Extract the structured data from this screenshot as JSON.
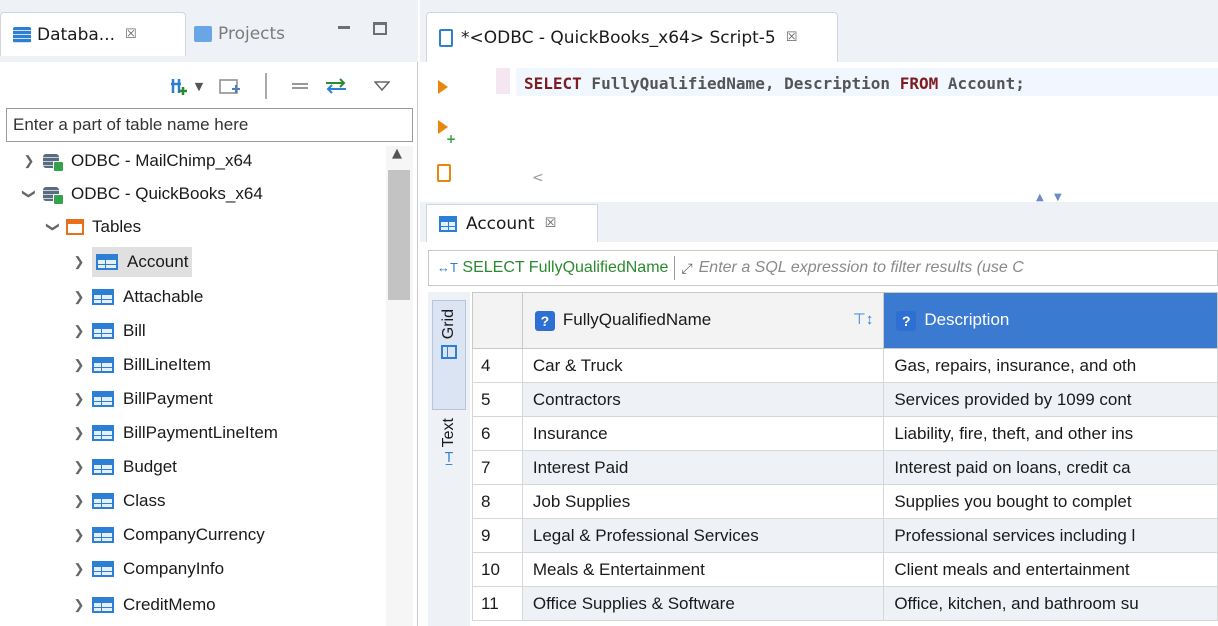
{
  "left_panel": {
    "tabs": [
      {
        "label": "Databa...",
        "close": "☒"
      },
      {
        "label": "Projects"
      }
    ],
    "filter_placeholder": "Enter a part of table name here",
    "tree": [
      {
        "label": "ODBC - MailChimp_x64",
        "type": "connection",
        "expanded": false
      },
      {
        "label": "ODBC - QuickBooks_x64",
        "type": "connection",
        "expanded": true
      },
      {
        "label": "Tables",
        "type": "folder",
        "expanded": true
      },
      {
        "label": "Account",
        "type": "table",
        "selected": true
      },
      {
        "label": "Attachable",
        "type": "table"
      },
      {
        "label": "Bill",
        "type": "table"
      },
      {
        "label": "BillLineItem",
        "type": "table"
      },
      {
        "label": "BillPayment",
        "type": "table"
      },
      {
        "label": "BillPaymentLineItem",
        "type": "table"
      },
      {
        "label": "Budget",
        "type": "table"
      },
      {
        "label": "Class",
        "type": "table"
      },
      {
        "label": "CompanyCurrency",
        "type": "table"
      },
      {
        "label": "CompanyInfo",
        "type": "table"
      },
      {
        "label": "CreditMemo",
        "type": "table"
      }
    ]
  },
  "editor": {
    "tab_label": "*<ODBC - QuickBooks_x64> Script-5",
    "tab_close": "☒",
    "sql": {
      "kw_select": "SELECT",
      "columns": " FullyQualifiedName, Description ",
      "kw_from": "FROM",
      "table": " Account;"
    }
  },
  "results": {
    "tab_label": "Account",
    "tab_close": "☒",
    "filter_query": "SELECT FullyQualifiedName",
    "filter_placeholder": "Enter a SQL expression to filter results (use C",
    "side_tabs": [
      "Grid",
      "Text"
    ],
    "columns": [
      "FullyQualifiedName",
      "Description"
    ],
    "rows": [
      {
        "num": "4",
        "name": "Car & Truck",
        "desc": "Gas, repairs, insurance, and oth"
      },
      {
        "num": "5",
        "name": "Contractors",
        "desc": "Services provided by 1099 cont"
      },
      {
        "num": "6",
        "name": "Insurance",
        "desc": "Liability, fire, theft, and other ins"
      },
      {
        "num": "7",
        "name": "Interest Paid",
        "desc": "Interest paid on loans, credit ca"
      },
      {
        "num": "8",
        "name": "Job Supplies",
        "desc": "Supplies you bought to complet"
      },
      {
        "num": "9",
        "name": "Legal & Professional Services",
        "desc": "Professional services including l"
      },
      {
        "num": "10",
        "name": "Meals & Entertainment",
        "desc": "Client meals and entertainment"
      },
      {
        "num": "11",
        "name": "Office Supplies & Software",
        "desc": "Office, kitchen, and bathroom su"
      }
    ]
  },
  "colors": {
    "accent_blue": "#3b7ad1",
    "keyword": "#7d1d20",
    "filter_green": "#2a8b2e",
    "run_orange": "#e8870c"
  },
  "icons": {
    "run": "play-icon",
    "table": "table-icon",
    "connection": "database-icon",
    "folder": "folder-icon"
  }
}
